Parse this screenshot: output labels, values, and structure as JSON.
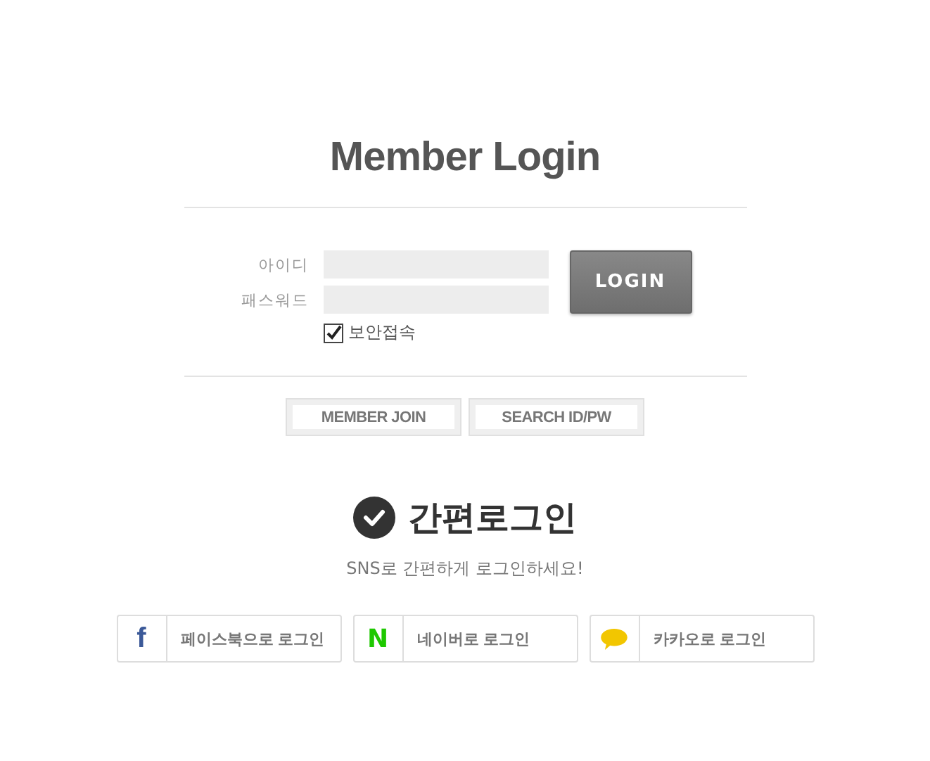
{
  "title": "Member Login",
  "form": {
    "fields": [
      {
        "label": "아이디"
      },
      {
        "label": "패스워드"
      }
    ],
    "secure": {
      "label": "보안접속",
      "checked": true
    },
    "login_button": "LOGIN"
  },
  "links": [
    "MEMBER JOIN",
    "SEARCH ID/PW"
  ],
  "easy_login": {
    "title": "간편로그인",
    "subtitle": "SNS로 간편하게 로그인하세요!",
    "buttons": [
      {
        "kind": "facebook",
        "glyph": "f",
        "label": "페이스북으로 로그인"
      },
      {
        "kind": "naver",
        "glyph": "N",
        "label": "네이버로 로그인"
      },
      {
        "kind": "kakao",
        "label": "카카오로 로그인"
      }
    ]
  }
}
